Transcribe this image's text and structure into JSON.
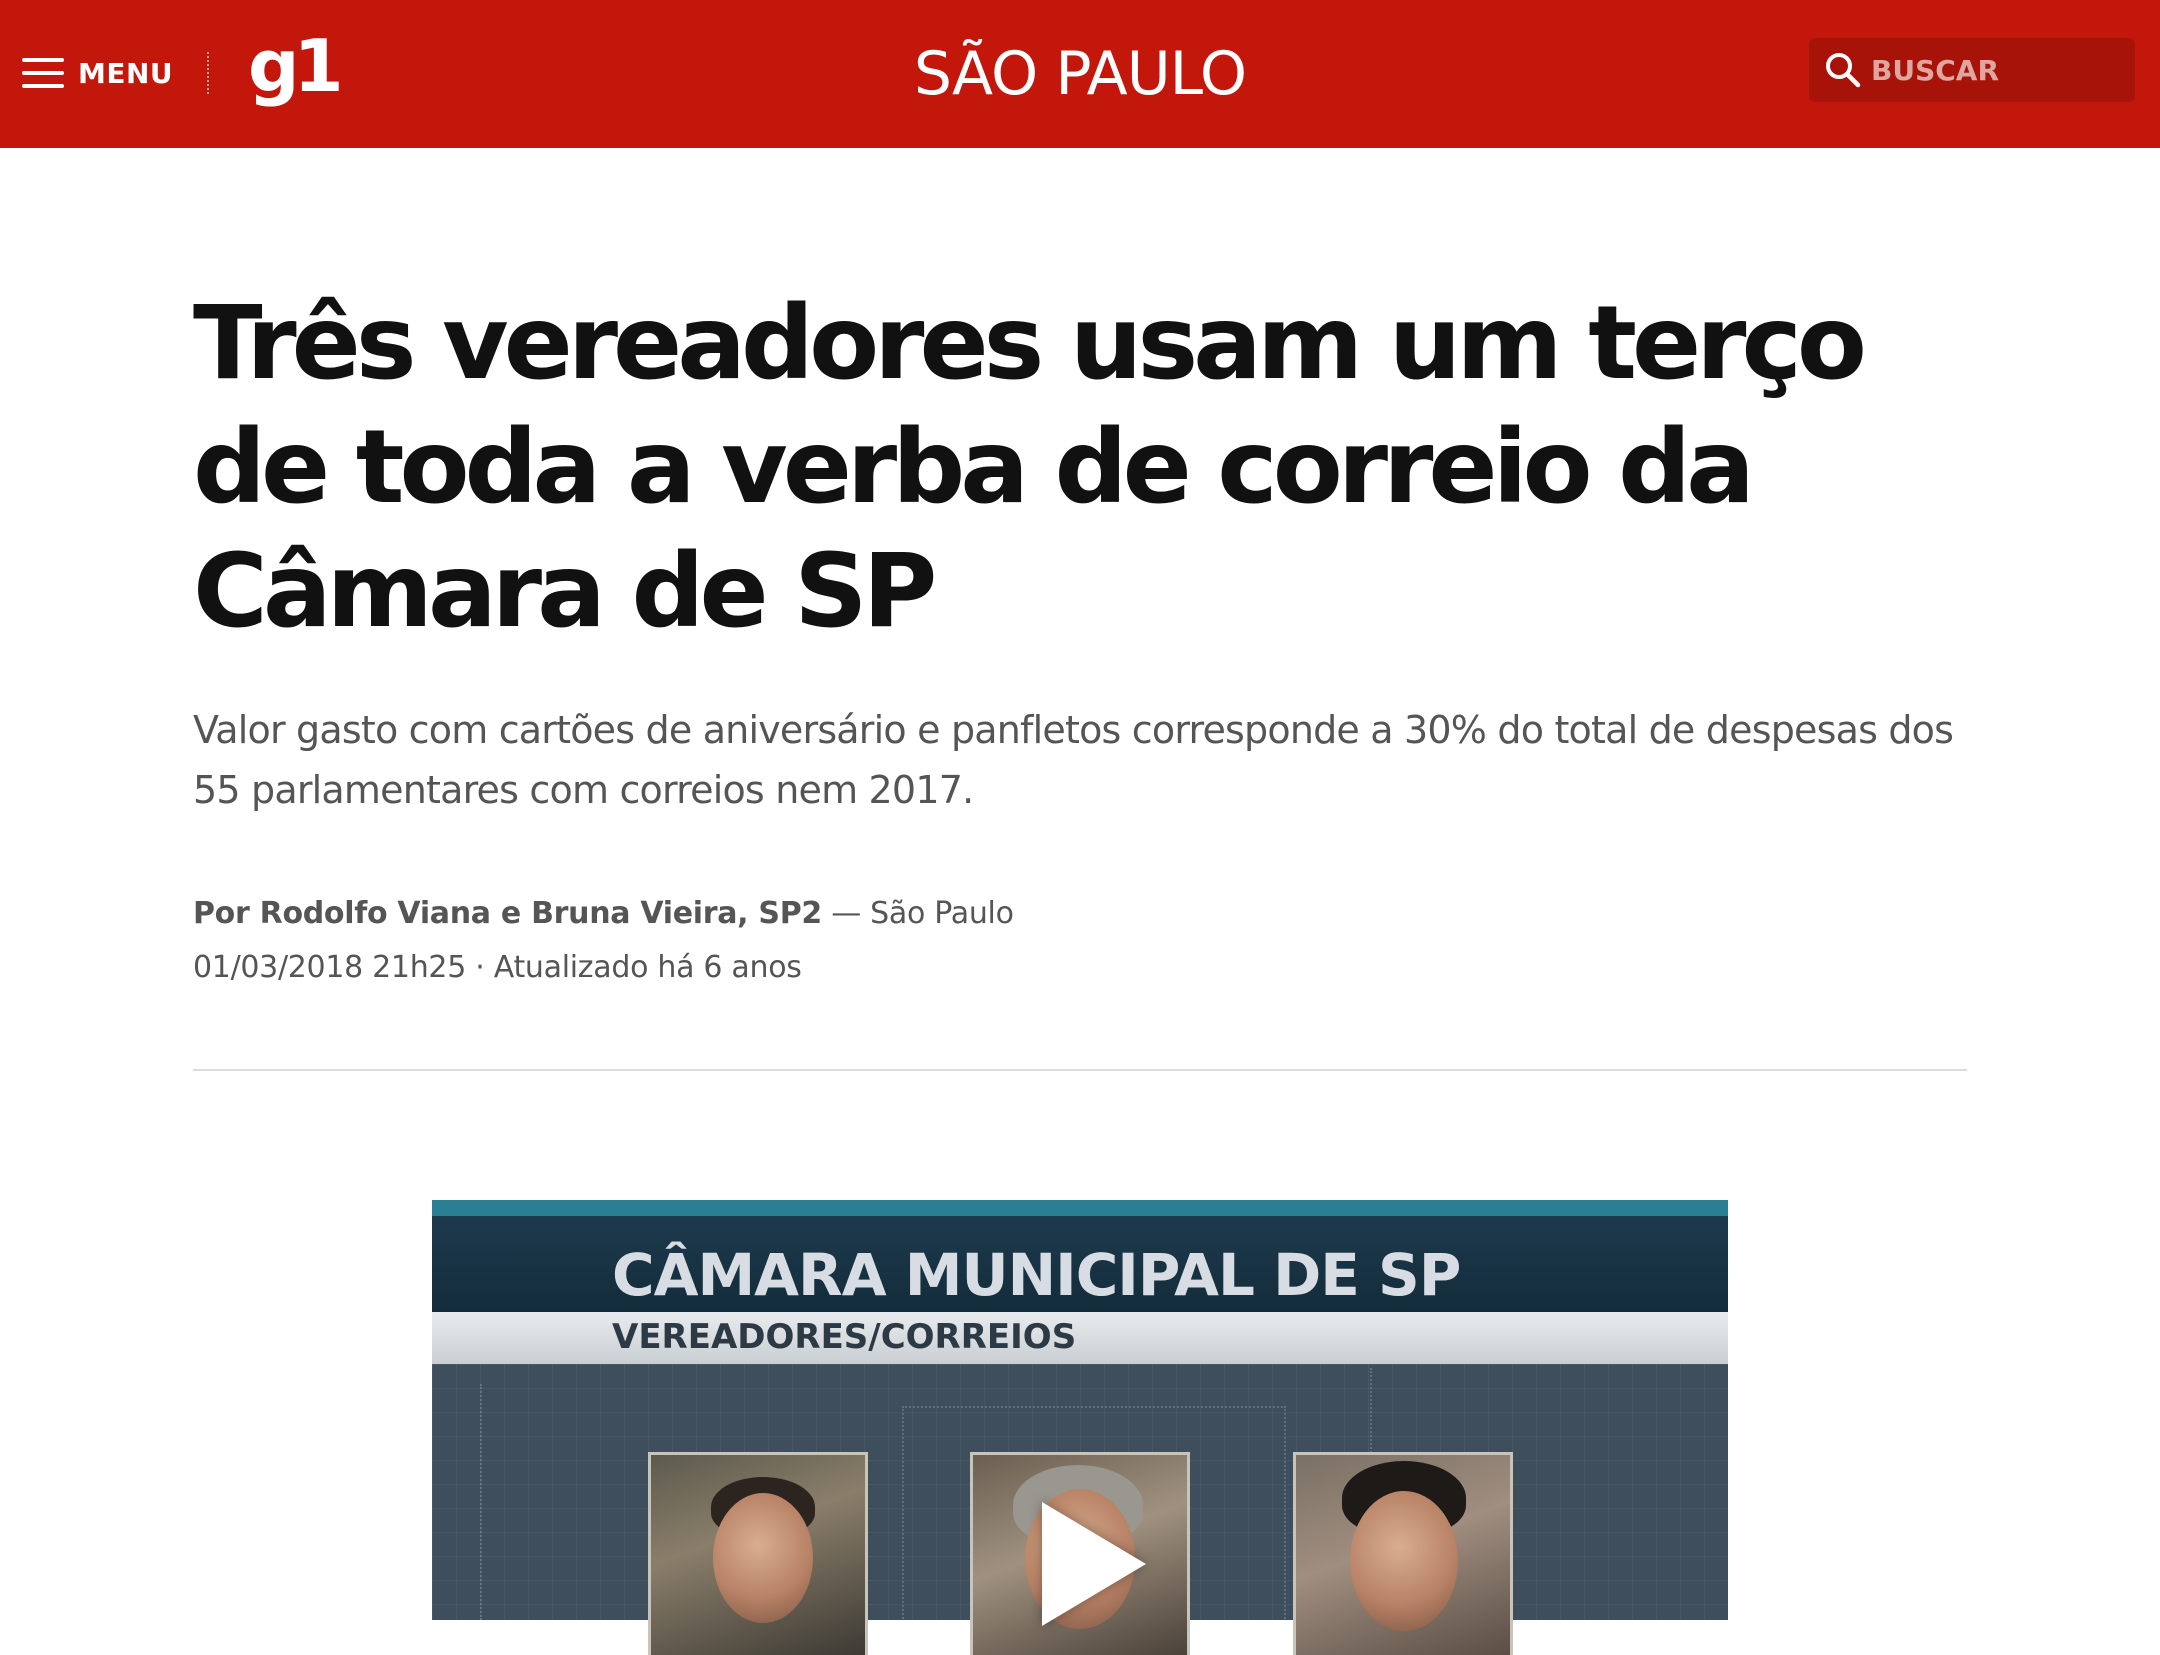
{
  "header": {
    "menu_label": "MENU",
    "logo": "g1",
    "section": "SÃO PAULO",
    "search_placeholder": "BUSCAR",
    "brand_color": "#c4170c"
  },
  "article": {
    "headline": "Três vereadores usam um terço de toda a verba de correio da Câmara de SP",
    "subtitle": "Valor gasto com cartões de aniversário e panfletos corresponde a 30% do total de despesas dos 55 parlamentares com correios nem 2017.",
    "authors": "Por Rodolfo Viana e Bruna Vieira, SP2",
    "location": "— São Paulo",
    "date": "01/03/2018 21h25",
    "separator": "·",
    "updated": "Atualizado há 6 anos"
  },
  "video": {
    "title": "CÂMARA MUNICIPAL DE SP",
    "subtitle": "VEREADORES/CORREIOS"
  },
  "icons": {
    "menu": "hamburger-icon",
    "search": "search-icon",
    "play": "play-icon"
  }
}
